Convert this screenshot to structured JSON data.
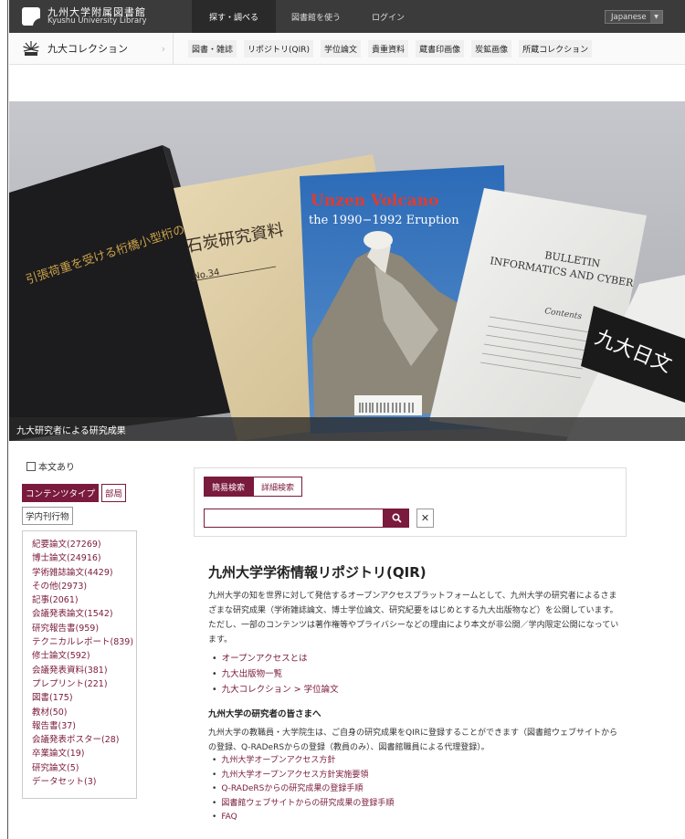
{
  "header": {
    "logo_jp": "九州大学附属図書館",
    "logo_en": "Kyushu University Library",
    "nav": [
      "探す・調べる",
      "図書館を使う",
      "ログイン"
    ],
    "language": "Japanese"
  },
  "collection_bar": {
    "home_label": "九大コレクション",
    "links": [
      "図書・雑誌",
      "リポジトリ(QIR)",
      "学位論文",
      "貴重資料",
      "蔵書印画像",
      "炭鉱画像",
      "所蔵コレクション"
    ]
  },
  "hero": {
    "caption": "九大研究者による研究成果",
    "book1_title": "引張荷重を受ける桁橋小型桁の曲損および振動特性に関する研究",
    "book2_title": "石炭研究資料",
    "book2_no": "No.34",
    "book3_title1": "Unzen Volcano",
    "book3_title2": "the 1990−1992 Eruption",
    "book4_title1": "BULLETIN",
    "book4_title2": "INFORMATICS AND CYBER",
    "book4_contents": "Contents",
    "book5_title": "九大日文"
  },
  "sidebar": {
    "fulltext_label": "本文あり",
    "facet_tabs": [
      "コンテンツタイプ",
      "部局",
      "学内刊行物"
    ],
    "items": [
      "紀要論文(27269)",
      "博士論文(24916)",
      "学術雑誌論文(4429)",
      "その他(2973)",
      "記事(2061)",
      "会議発表論文(1542)",
      "研究報告書(959)",
      "テクニカルレポート(839)",
      "修士論文(592)",
      "会議発表資料(381)",
      "プレプリント(221)",
      "図書(175)",
      "教材(50)",
      "報告書(37)",
      "会議発表ポスター(28)",
      "卒業論文(19)",
      "研究論文(5)",
      "データセット(3)"
    ]
  },
  "search": {
    "tabs": [
      "簡易検索",
      "詳細検索"
    ],
    "value": "",
    "placeholder": ""
  },
  "main": {
    "title": "九州大学学術情報リポジトリ(QIR)",
    "intro": "九州大学の知を世界に対して発信するオープンアクセスプラットフォームとして、九州大学の研究者によるさまざまな研究成果（学術雑誌論文、博士学位論文、研究紀要をはじめとする九大出版物など）を公開しています。ただし、一部のコンテンツは著作権等やプライバシーなどの理由により本文が非公開／学内限定公開になっています。",
    "links1": [
      "オープンアクセスとは",
      "九大出版物一覧",
      "九大コレクション > 学位論文"
    ],
    "subhead": "九州大学の研究者の皆さまへ",
    "desc": "九州大学の教職員・大学院生は、ご自身の研究成果をQIRに登録することができます（図書館ウェブサイトからの登録、Q-RADeRSからの登録（教員のみ）、図書館職員による代理登録）。",
    "links2": [
      "九州大学オープンアクセス方針",
      "九州大学オープンアクセス方針実施要領",
      "Q-RADeRSからの研究成果の登録手順",
      "図書館ウェブサイトからの研究成果の登録手順",
      "FAQ"
    ]
  },
  "colors": {
    "accent": "#7a1a3c",
    "topbar": "#3b3b3b"
  }
}
